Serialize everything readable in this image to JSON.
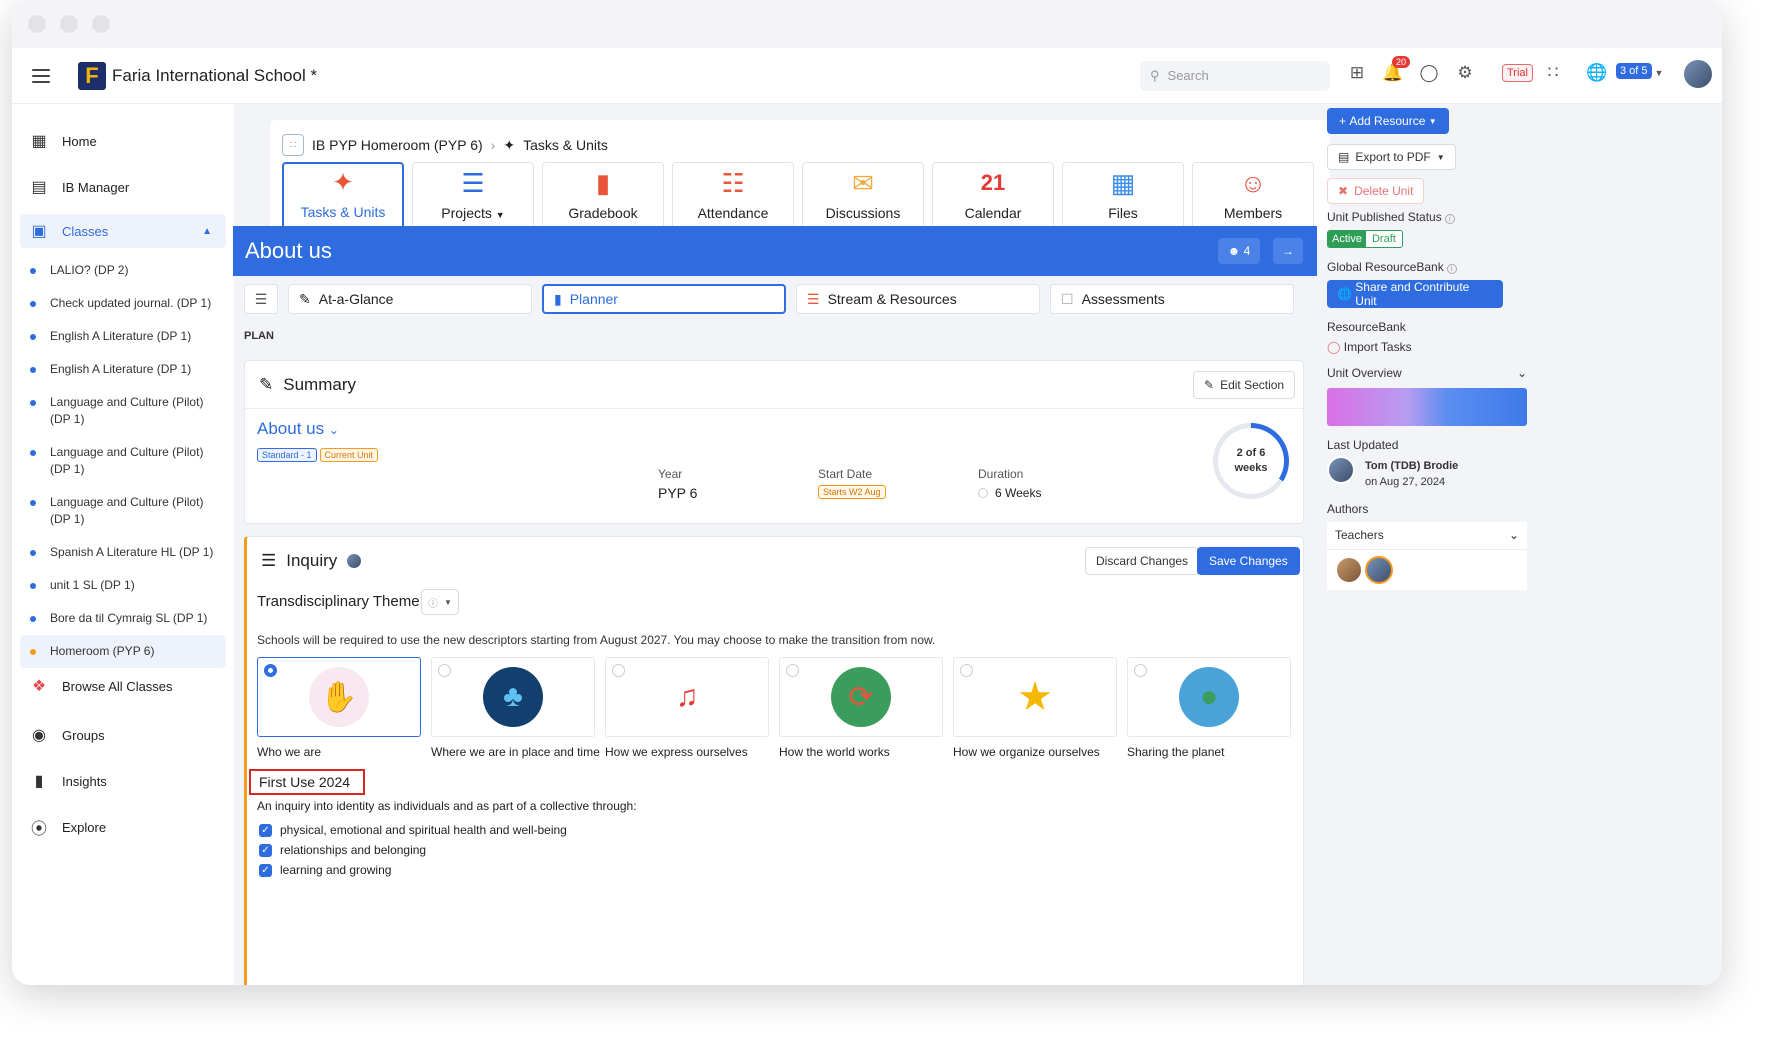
{
  "header": {
    "school_name": "Faria International School *",
    "logo_letter": "F",
    "search_placeholder": "Search",
    "notification_count": "20",
    "trial_label": "Trial",
    "pager": "3 of 5"
  },
  "sidebar": {
    "home": "Home",
    "ib_manager": "IB Manager",
    "classes": "Classes",
    "class_items": [
      "LALIO? (DP 2)",
      "Check updated journal. (DP 1)",
      "English A Literature (DP 1)",
      "English A Literature (DP 1)",
      "Language and Culture (Pilot) (DP 1)",
      "Language and Culture (Pilot) (DP 1)",
      "Language and Culture (Pilot) (DP 1)",
      "Spanish A Literature HL (DP 1)",
      "unit 1 SL (DP 1)",
      "Bore da til Cymraig SL (DP 1)",
      "Homeroom (PYP 6)"
    ],
    "browse_all": "Browse All Classes",
    "groups": "Groups",
    "insights": "Insights",
    "explore": "Explore"
  },
  "breadcrumb": {
    "class_name": "IB PYP Homeroom (PYP 6)",
    "current": "Tasks & Units"
  },
  "tabs": [
    "Tasks & Units",
    "Projects",
    "Gradebook",
    "Attendance",
    "Discussions",
    "Calendar",
    "Files",
    "Members"
  ],
  "calendar_day": "21",
  "unit": {
    "title": "About us",
    "members_count": "4",
    "subtabs": [
      "At-a-Glance",
      "Planner",
      "Stream & Resources",
      "Assessments"
    ],
    "plan_label": "PLAN"
  },
  "summary": {
    "heading": "Summary",
    "edit_button": "Edit Section",
    "unit_name": "About us",
    "tag_standard": "Standard - 1",
    "tag_current": "Current Unit",
    "year_label": "Year",
    "year_value": "PYP 6",
    "start_label": "Start Date",
    "start_value": "Starts W2 Aug",
    "duration_label": "Duration",
    "duration_value": "6 Weeks",
    "progress_line1": "2 of 6",
    "progress_line2": "weeks"
  },
  "inquiry": {
    "heading": "Inquiry",
    "discard_button": "Discard Changes",
    "save_button": "Save Changes",
    "td_theme_label": "Transdisciplinary Theme",
    "notice": "Schools will be required to use the new descriptors starting from August 2027. You may choose to make the transition from now.",
    "themes": [
      "Who we are",
      "Where we are in place and time",
      "How we express ourselves",
      "How the world works",
      "How we organize ourselves",
      "Sharing the planet"
    ],
    "first_use": "First Use 2024",
    "description": "An inquiry into identity as individuals and as part of a collective through:",
    "checklist": [
      "physical, emotional and spiritual health and well-being",
      "relationships and belonging",
      "learning and growing"
    ]
  },
  "right": {
    "add_resource": "Add Resource",
    "export_pdf": "Export to PDF",
    "delete_unit": "Delete Unit",
    "published_status_label": "Unit Published Status",
    "status_active": "Active",
    "status_draft": "Draft",
    "global_bank_label": "Global ResourceBank",
    "share_button": "Share and Contribute Unit",
    "resource_bank_label": "ResourceBank",
    "import_tasks": "Import Tasks",
    "unit_overview": "Unit Overview",
    "last_updated_label": "Last Updated",
    "updated_by": "Tom (TDB) Brodie",
    "updated_on": "on Aug 27, 2024",
    "authors_label": "Authors",
    "authors_select": "Teachers"
  },
  "colors": {
    "primary": "#2e6cdf",
    "active_green": "#2e9e57",
    "highlight_red": "#d62828"
  }
}
